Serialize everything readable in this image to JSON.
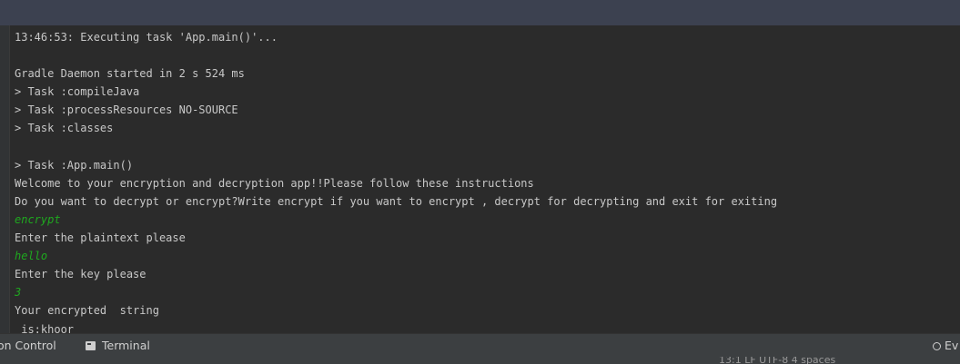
{
  "console": {
    "lines": [
      {
        "text": "13:46:53: Executing task 'App.main()'...",
        "type": "output"
      },
      {
        "text": "",
        "type": "output"
      },
      {
        "text": "Gradle Daemon started in 2 s 524 ms",
        "type": "output"
      },
      {
        "text": "> Task :compileJava",
        "type": "output"
      },
      {
        "text": "> Task :processResources NO-SOURCE",
        "type": "output"
      },
      {
        "text": "> Task :classes",
        "type": "output"
      },
      {
        "text": "",
        "type": "output"
      },
      {
        "text": "> Task :App.main()",
        "type": "output"
      },
      {
        "text": "Welcome to your encryption and decryption app!!Please follow these instructions",
        "type": "output"
      },
      {
        "text": "Do you want to decrypt or encrypt?Write encrypt if you want to encrypt , decrypt for decrypting and exit for exiting",
        "type": "output"
      },
      {
        "text": "encrypt",
        "type": "input"
      },
      {
        "text": "Enter the plaintext please",
        "type": "output"
      },
      {
        "text": "hello",
        "type": "input"
      },
      {
        "text": "Enter the key please",
        "type": "output"
      },
      {
        "text": "3",
        "type": "input"
      },
      {
        "text": "Your encrypted  string",
        "type": "output"
      },
      {
        "text": " is:khoor",
        "type": "output"
      }
    ]
  },
  "bottom_bar": {
    "version_control_label": "on Control",
    "terminal_label": "Terminal",
    "event_log_label": "Ev"
  },
  "status_bar": {
    "text": "13:1   LF   UTF-8   4 spaces"
  },
  "colors": {
    "console_bg": "#2b2b2b",
    "output_text": "#c8c8c8",
    "input_text": "#1fa81f",
    "toolbar_bg": "#3c3f41"
  }
}
